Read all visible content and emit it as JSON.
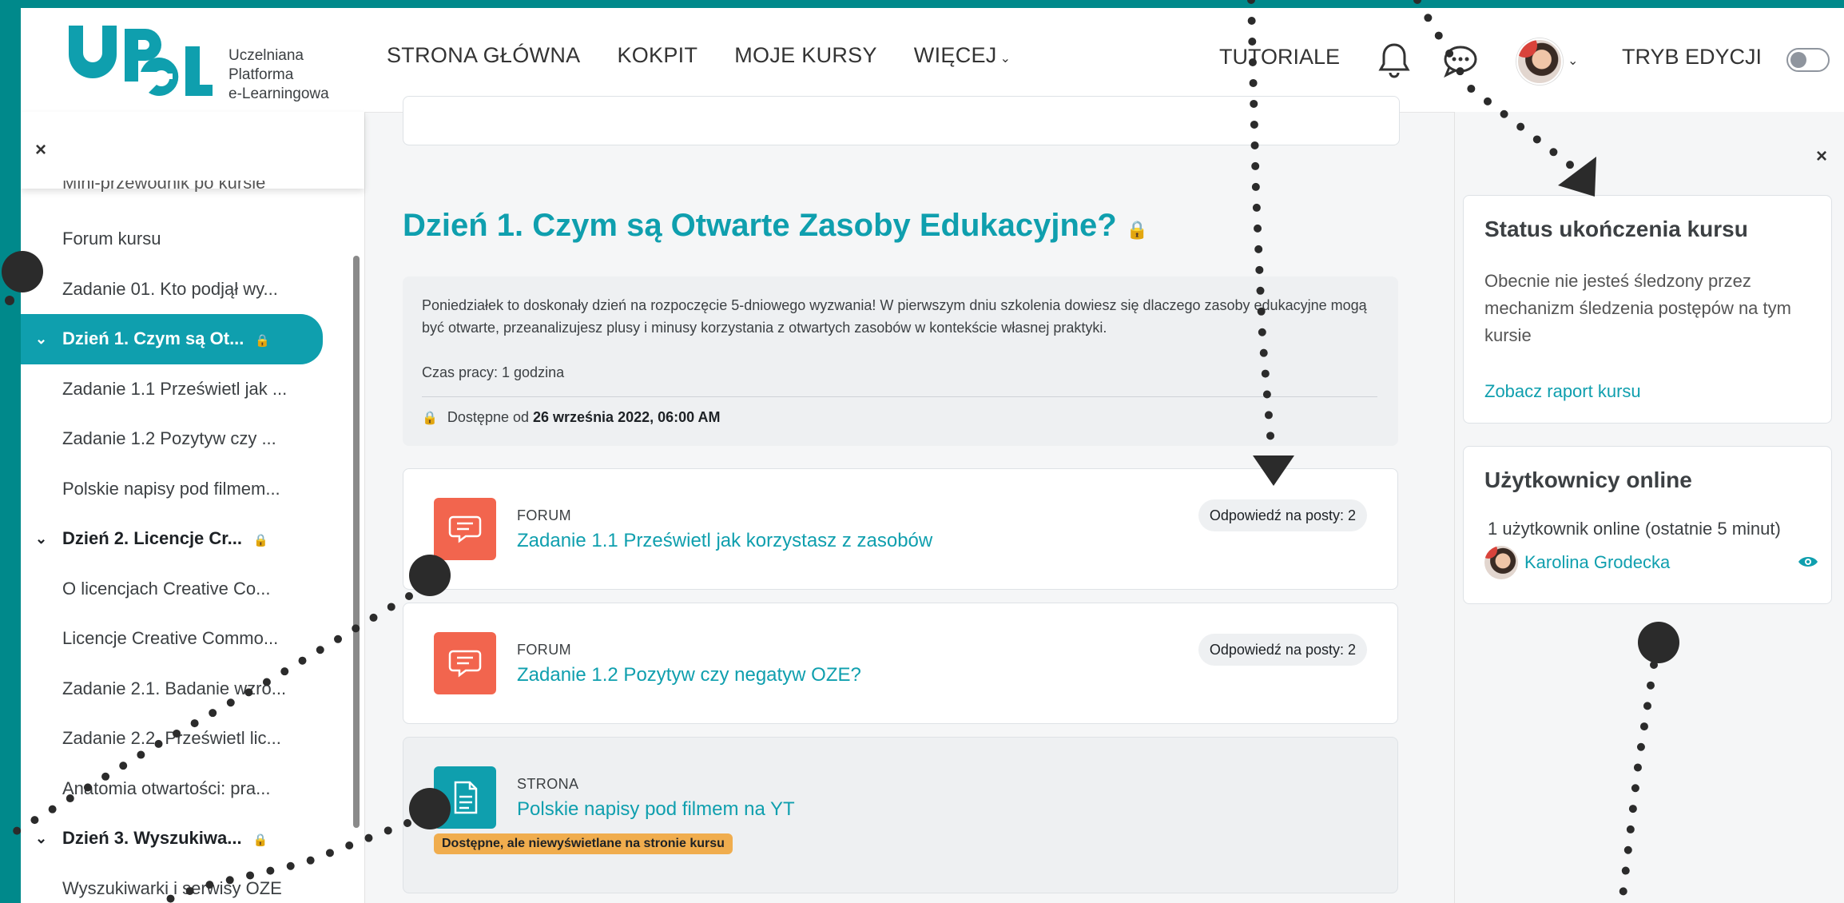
{
  "logo": {
    "line1": "Uczelniana",
    "line2": "Platforma",
    "line3": "e-Learningowa"
  },
  "nav": [
    {
      "label": "STRONA GŁÓWNA"
    },
    {
      "label": "KOKPIT"
    },
    {
      "label": "MOJE KURSY"
    },
    {
      "label": "WIĘCEJ",
      "chevron": "chevron-down-icon"
    }
  ],
  "header_right": {
    "tutorials": "TUTORIALE",
    "edit_mode": "TRYB EDYCJI",
    "notifications_icon": "bell-icon",
    "messages_icon": "chat-icon"
  },
  "left_drawer": {
    "close": "×",
    "cut_item": "Mini-przewodnik po kursie",
    "items": [
      {
        "label": "Forum kursu",
        "type": "item"
      },
      {
        "label": "Zadanie 01. Kto podjął wy...",
        "type": "item"
      },
      {
        "label": "Dzień 1. Czym są Ot...",
        "type": "section",
        "active": true
      },
      {
        "label": "Zadanie 1.1 Prześwietl jak ...",
        "type": "item"
      },
      {
        "label": "Zadanie 1.2 Pozytyw czy ...",
        "type": "item"
      },
      {
        "label": "Polskie napisy pod filmem...",
        "type": "item"
      },
      {
        "label": "Dzień 2. Licencje Cr...",
        "type": "section"
      },
      {
        "label": "O licencjach Creative Co...",
        "type": "item"
      },
      {
        "label": "Licencje Creative Commo...",
        "type": "item"
      },
      {
        "label": "Zadanie 2.1. Badanie wzro...",
        "type": "item"
      },
      {
        "label": "Zadanie 2.2. Prześwietl lic...",
        "type": "item"
      },
      {
        "label": "Anatomia otwartości: pra...",
        "type": "item"
      },
      {
        "label": "Dzień 3. Wyszukiwa...",
        "type": "section"
      },
      {
        "label": "Wyszukiwarki i serwisy OZE",
        "type": "item"
      }
    ]
  },
  "main": {
    "section_title": "Dzień 1. Czym są Otwarte Zasoby Edukacyjne?",
    "summary": {
      "text": "Poniedziałek to doskonały dzień na rozpoczęcie 5-dniowego wyzwania! W pierwszym dniu szkolenia dowiesz się dlaczego zasoby edukacyjne mogą być otwarte, przeanalizujesz plusy i minusy korzystania z otwartych zasobów w kontekście własnej praktyki.",
      "work_time": "Czas pracy: 1 godzina",
      "available_prefix": "Dostępne od",
      "available_date": "26 września 2022, 06:00 AM"
    },
    "activities": [
      {
        "type": "FORUM",
        "name": "Zadanie 1.1 Prześwietl jak korzystasz z zasobów",
        "badge": "Odpowiedź na posty: 2"
      },
      {
        "type": "FORUM",
        "name": "Zadanie 1.2 Pozytyw czy negatyw OZE?",
        "badge": "Odpowiedź na posty: 2"
      },
      {
        "type": "STRONA",
        "name": "Polskie napisy pod filmem na YT",
        "tag": "Dostępne, ale niewyświetlane na stronie kursu"
      }
    ]
  },
  "right_drawer": {
    "close": "×",
    "completion": {
      "title": "Status ukończenia kursu",
      "text": "Obecnie nie jesteś śledzony przez mechanizm śledzenia postępów na tym kursie",
      "link": "Zobacz raport kursu"
    },
    "online": {
      "title": "Użytkownicy online",
      "count": "1 użytkownik online (ostatnie 5 minut)",
      "user": "Karolina Grodecka"
    }
  },
  "colors": {
    "teal": "#0f9fae",
    "forum": "#f2654e",
    "frame": "#00898b",
    "tag": "#f0ad4e"
  }
}
